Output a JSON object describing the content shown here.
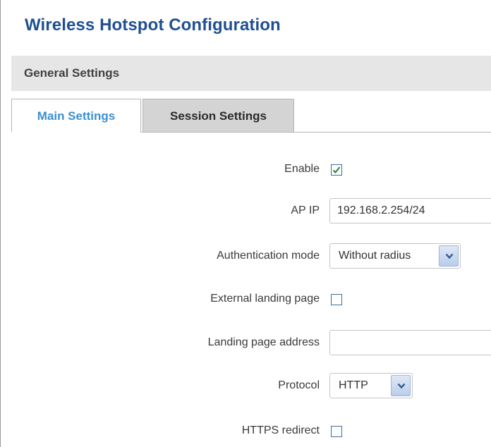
{
  "page": {
    "title": "Wireless Hotspot Configuration"
  },
  "section": {
    "title": "General Settings"
  },
  "tabs": [
    {
      "label": "Main Settings",
      "active": true
    },
    {
      "label": "Session Settings",
      "active": false
    }
  ],
  "form": {
    "enable": {
      "label": "Enable",
      "checked": true
    },
    "ap_ip": {
      "label": "AP IP",
      "value": "192.168.2.254/24"
    },
    "auth_mode": {
      "label": "Authentication mode",
      "value": "Without radius"
    },
    "external_landing": {
      "label": "External landing page",
      "checked": false
    },
    "landing_address": {
      "label": "Landing page address",
      "value": ""
    },
    "protocol": {
      "label": "Protocol",
      "value": "HTTP"
    },
    "https_redirect": {
      "label": "HTTPS redirect",
      "checked": false
    }
  },
  "colors": {
    "title": "#1f4f93",
    "active_tab": "#3b8fd1",
    "checkbox_border": "#3a6da7",
    "check_mark": "#2e8b3a"
  }
}
